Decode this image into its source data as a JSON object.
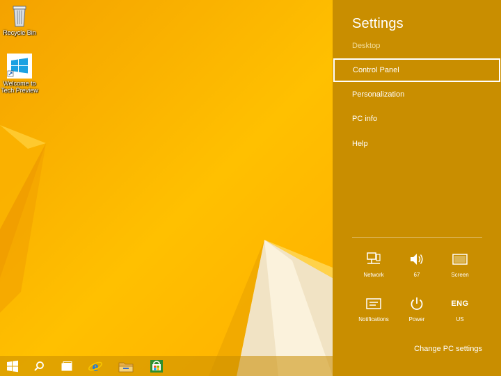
{
  "desktop": {
    "icons": [
      {
        "label": "Recycle Bin"
      },
      {
        "label": "Welcome to Tech Preview"
      }
    ]
  },
  "taskbar": {
    "items": [
      "start-icon",
      "search-icon",
      "task-view-icon",
      "internet-explorer-icon",
      "file-explorer-icon",
      "store-icon"
    ]
  },
  "settings": {
    "title": "Settings",
    "context": "Desktop",
    "items": [
      {
        "label": "Control Panel",
        "selected": true
      },
      {
        "label": "Personalization"
      },
      {
        "label": "PC info"
      },
      {
        "label": "Help"
      }
    ],
    "quick": [
      {
        "icon": "network-icon",
        "label": "Network"
      },
      {
        "icon": "volume-icon",
        "label": "67"
      },
      {
        "icon": "screen-icon",
        "label": "Screen"
      },
      {
        "icon": "notifications-icon",
        "label": "Notifications"
      },
      {
        "icon": "power-icon",
        "label": "Power"
      },
      {
        "icon": "keyboard-language",
        "label": "US",
        "top": "ENG"
      }
    ],
    "change_pc_settings": "Change PC settings"
  },
  "colors": {
    "pane": "#c98e00",
    "wallpaper": "#ffc000"
  }
}
